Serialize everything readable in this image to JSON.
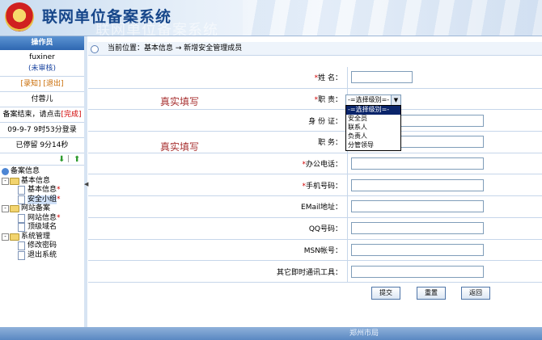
{
  "app": {
    "title": "联网单位备案系统",
    "subtitle": "联网单位备案系统"
  },
  "sidebar": {
    "header": "操作员",
    "username": "fuxiner",
    "status": "(未审核)",
    "links": {
      "notice": "[录知]",
      "logout": "[退出]"
    },
    "name": "付蓉儿",
    "finish_text": "备案结束，请点击",
    "finish_link": "[完成]",
    "login_time": "09-9-7 9时53分登录",
    "online_time": "已停留 9分14秒",
    "tree": {
      "root": "备案信息",
      "groups": [
        {
          "label": "基本信息",
          "items": [
            {
              "label": "基本信息",
              "mark": "*"
            },
            {
              "label": "安全小组",
              "mark": "*"
            }
          ]
        },
        {
          "label": "网站备案",
          "items": [
            {
              "label": "网站信息",
              "mark": "*"
            },
            {
              "label": "顶级域名",
              "mark": ""
            }
          ]
        },
        {
          "label": "系统管理",
          "items": [
            {
              "label": "修改密码",
              "mark": ""
            },
            {
              "label": "退出系统",
              "mark": ""
            }
          ]
        }
      ]
    }
  },
  "breadcrumb": {
    "text": "当前位置：基本信息 → 新增安全管理成员"
  },
  "form": {
    "hint_1": "真实填写",
    "hint_2": "真实填写",
    "fields": [
      {
        "label": "姓    名：",
        "required": "*"
      },
      {
        "label": "职    责：",
        "required": "*"
      },
      {
        "label": "身 份 证：",
        "required": ""
      },
      {
        "label": "职    务：",
        "required": ""
      },
      {
        "label": "办公电话：",
        "required": "*"
      },
      {
        "label": "手机号码：",
        "required": "*"
      },
      {
        "label": "EMail地址：",
        "required": ""
      },
      {
        "label": "QQ号码：",
        "required": ""
      },
      {
        "label": "MSN帐号：",
        "required": ""
      },
      {
        "label": "其它即时通讯工具：",
        "required": ""
      }
    ],
    "select_value": "-=选择级别=-",
    "dropdown_options": [
      "-=选择级别=-",
      "安全员",
      "联系人",
      "负责人",
      "分管领导"
    ],
    "buttons": {
      "submit": "提交",
      "reset": "重置",
      "back": "返回"
    }
  },
  "footer": {
    "text": "郑州市局"
  }
}
